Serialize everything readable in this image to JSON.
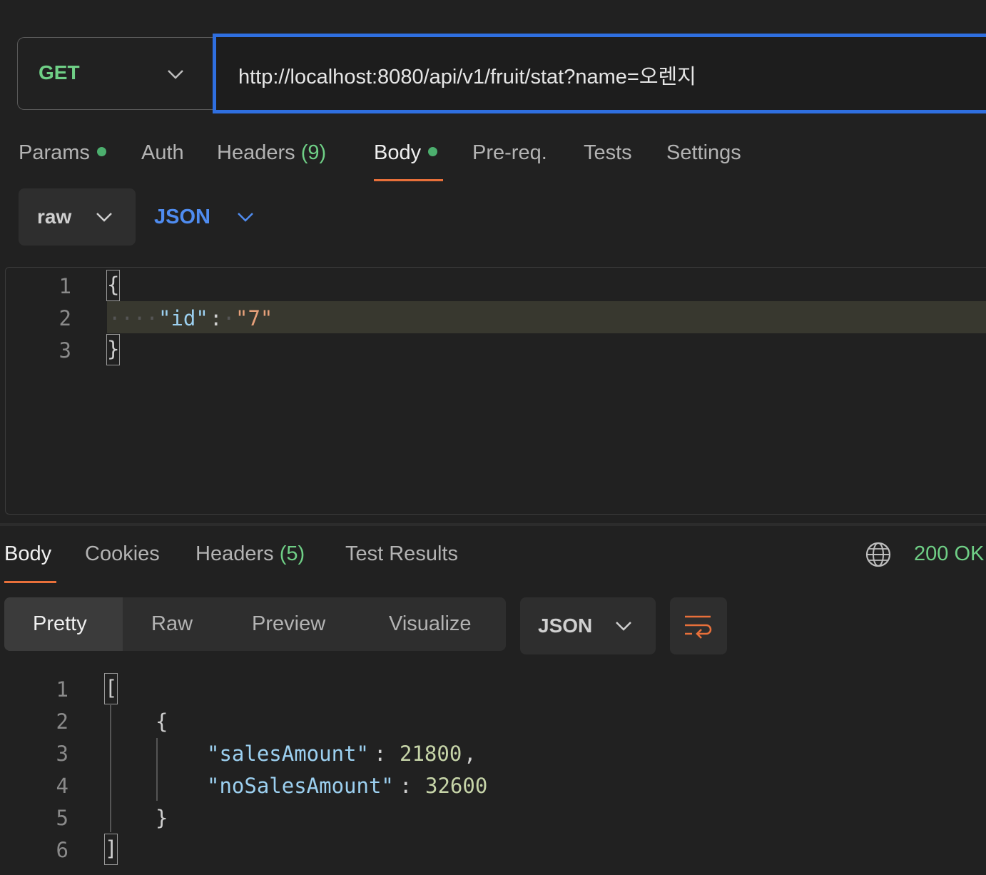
{
  "request": {
    "method": "GET",
    "url": "http://localhost:8080/api/v1/fruit/stat?name=오렌지",
    "tabs": {
      "params": "Params",
      "auth": "Auth",
      "headers": "Headers",
      "headers_count": "(9)",
      "body": "Body",
      "prereq": "Pre-req.",
      "tests": "Tests",
      "settings": "Settings"
    },
    "body_mode": "raw",
    "body_format": "JSON",
    "editor": {
      "line_numbers": [
        "1",
        "2",
        "3"
      ],
      "open_brace": "{",
      "close_brace": "}",
      "key": "\"id\"",
      "colon": ":",
      "value": "\"7\""
    }
  },
  "response": {
    "tabs": {
      "body": "Body",
      "cookies": "Cookies",
      "headers": "Headers",
      "headers_count": "(5)",
      "test_results": "Test Results"
    },
    "status": "200 OK",
    "view_modes": {
      "pretty": "Pretty",
      "raw": "Raw",
      "preview": "Preview",
      "visualize": "Visualize"
    },
    "format": "JSON",
    "editor": {
      "line_numbers": [
        "1",
        "2",
        "3",
        "4",
        "5",
        "6"
      ],
      "open_bracket": "[",
      "open_brace": "{",
      "key1": "\"salesAmount\"",
      "val1": "21800",
      "comma": ",",
      "colon": ":",
      "key2": "\"noSalesAmount\"",
      "val2": "32600",
      "close_brace": "}",
      "close_bracket": "]"
    }
  },
  "colors": {
    "accent": "#e8703a",
    "method_green": "#6fcf86",
    "url_focus": "#2f6fe0",
    "json_blue": "#4f8cf0"
  }
}
